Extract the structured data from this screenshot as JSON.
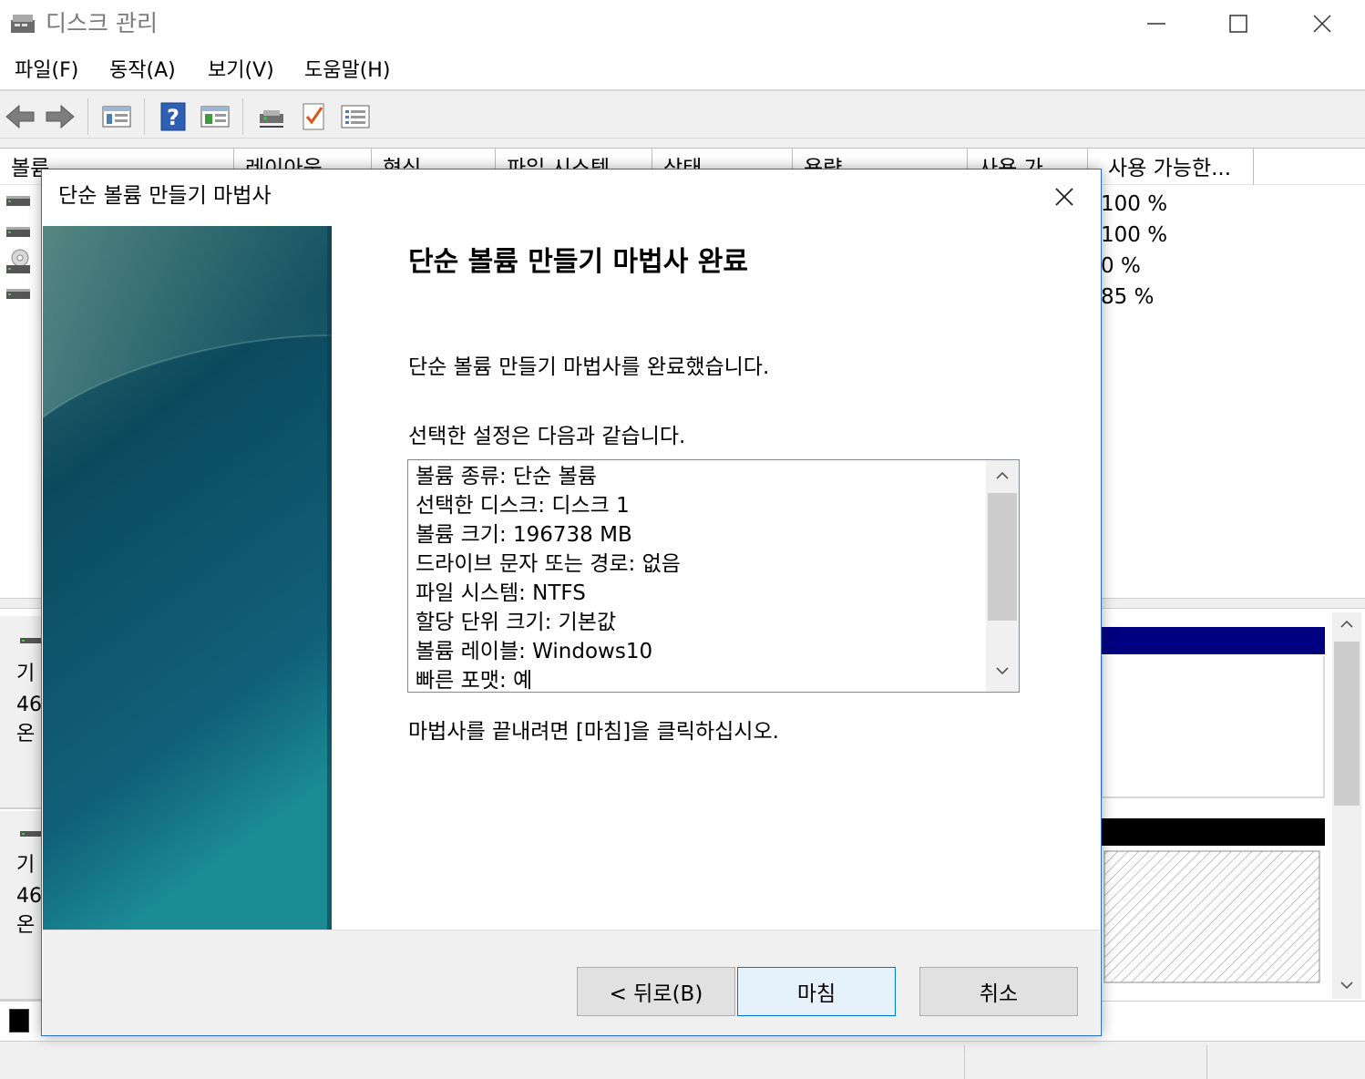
{
  "window": {
    "title": "디스크 관리",
    "minimize_icon": "minimize-icon",
    "maximize_icon": "maximize-icon",
    "close_icon": "close-icon"
  },
  "menu": [
    "파일(F)",
    "동작(A)",
    "보기(V)",
    "도움말(H)"
  ],
  "toolbar": {
    "icons": [
      "back-arrow-icon",
      "forward-arrow-icon",
      "disk-list-icon",
      "help-icon",
      "console-tree-icon",
      "connect-icon",
      "check-properties-icon",
      "view-list-icon"
    ]
  },
  "volume_list": {
    "columns": [
      "볼륨",
      "레이아웃",
      "형식",
      "파일 시스템",
      "상태",
      "용량",
      "사용 가",
      "사용 가능한..."
    ],
    "free_percent": [
      "100 %",
      "100 %",
      "0 %",
      "85 %"
    ]
  },
  "disks": [
    {
      "label_fragments": [
        "기",
        "46",
        "온"
      ]
    },
    {
      "label_fragments": [
        "기",
        "46",
        "온"
      ]
    }
  ],
  "colors": {
    "dialog_border": "#2b6fc4",
    "primary_partition_header": "#000080",
    "unallocated_header": "#000000",
    "button_accent": "#0078d7",
    "banner_dark": "#0b4a5e",
    "banner_light": "#1b8c94"
  },
  "wizard": {
    "title": "단순 볼륨 만들기 마법사",
    "close_icon": "close-icon",
    "heading": "단순 볼륨 만들기 마법사 완료",
    "completed_text": "단순 볼륨 만들기 마법사를 완료했습니다.",
    "settings_label": "선택한 설정은 다음과 같습니다.",
    "summary": [
      "볼륨 종류: 단순 볼륨",
      "선택한 디스크: 디스크 1",
      "볼륨 크기: 196738 MB",
      "드라이브 문자 또는 경로: 없음",
      "파일 시스템: NTFS",
      "할당 단위 크기: 기본값",
      "볼륨 레이블: Windows10",
      "빠른 포맷: 예"
    ],
    "finish_text": "마법사를 끝내려면 [마침]을 클릭하십시오.",
    "buttons": {
      "back": "< 뒤로(B)",
      "finish": "마침",
      "cancel": "취소"
    }
  }
}
